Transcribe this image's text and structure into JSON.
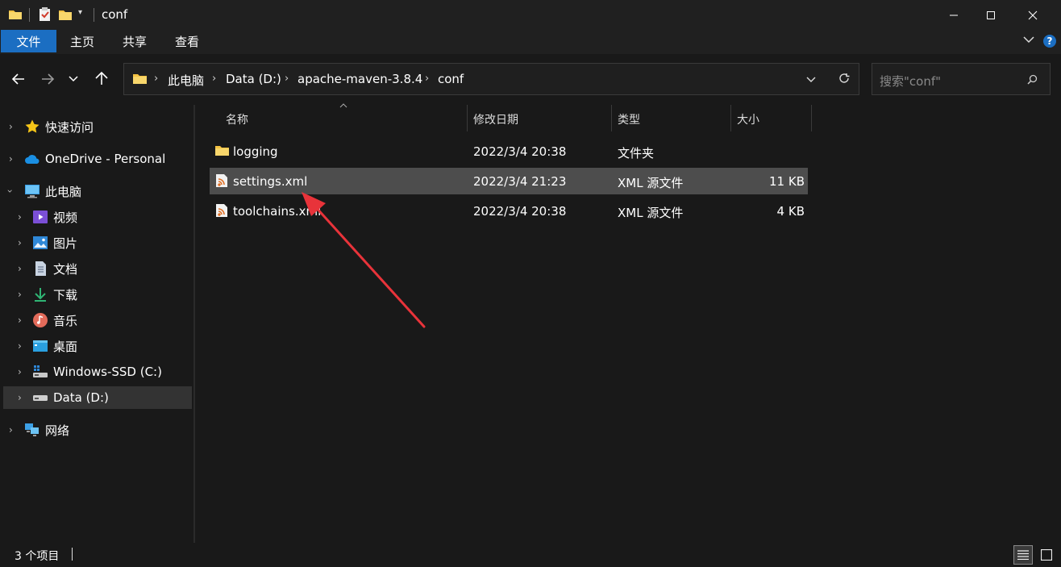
{
  "window": {
    "title": "conf",
    "controls": {
      "minimize": "—",
      "maximize": "☐",
      "close": "✕"
    }
  },
  "ribbon": {
    "tabs": [
      {
        "label": "文件",
        "active": true
      },
      {
        "label": "主页"
      },
      {
        "label": "共享"
      },
      {
        "label": "查看"
      }
    ]
  },
  "nav": {
    "breadcrumbs": [
      "此电脑",
      "Data (D:)",
      "apache-maven-3.8.4",
      "conf"
    ],
    "search_placeholder": "搜索\"conf\""
  },
  "sidebar": {
    "items": [
      {
        "label": "快速访问",
        "icon": "star-icon"
      },
      {
        "label": "OneDrive - Personal",
        "icon": "cloud-icon"
      },
      {
        "label": "此电脑",
        "icon": "computer-icon",
        "expanded": true
      },
      {
        "label": "视频",
        "icon": "video-icon"
      },
      {
        "label": "图片",
        "icon": "picture-icon"
      },
      {
        "label": "文档",
        "icon": "document-icon"
      },
      {
        "label": "下载",
        "icon": "download-icon"
      },
      {
        "label": "音乐",
        "icon": "music-icon"
      },
      {
        "label": "桌面",
        "icon": "desktop-icon"
      },
      {
        "label": "Windows-SSD (C:)",
        "icon": "drive-c-icon"
      },
      {
        "label": "Data (D:)",
        "icon": "drive-d-icon",
        "selected": true
      },
      {
        "label": "网络",
        "icon": "network-icon"
      }
    ]
  },
  "filelist": {
    "columns": {
      "name": "名称",
      "modified": "修改日期",
      "type": "类型",
      "size": "大小"
    },
    "rows": [
      {
        "name": "logging",
        "modified": "2022/3/4 20:38",
        "type": "文件夹",
        "size": "",
        "icon": "folder-icon"
      },
      {
        "name": "settings.xml",
        "modified": "2022/3/4 21:23",
        "type": "XML 源文件",
        "size": "11 KB",
        "icon": "xml-file-icon",
        "selected": true
      },
      {
        "name": "toolchains.xml",
        "modified": "2022/3/4 20:38",
        "type": "XML 源文件",
        "size": "4 KB",
        "icon": "xml-file-icon"
      }
    ]
  },
  "status": {
    "item_count": "3 个项目"
  },
  "colors": {
    "accent": "#1b6ec2",
    "selection": "#4d4d4d",
    "sidebar_selection": "#333333",
    "annotation_arrow": "#e8333a"
  }
}
